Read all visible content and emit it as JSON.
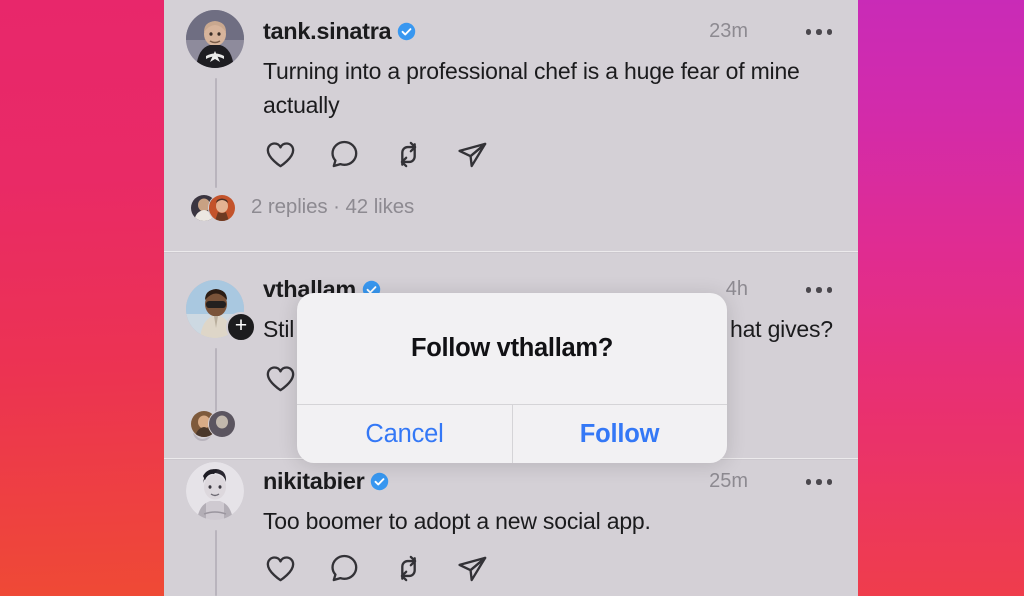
{
  "theme": {
    "background_gradient_left": "#e8276b",
    "background_gradient_right": "#c92bb7",
    "feed_background": "#d4d0d6",
    "verified_badge_color": "#3897f0",
    "alert_tint_color": "#3478f6",
    "text_primary": "#1b1b1d",
    "text_secondary": "#8d8a91"
  },
  "feed": {
    "posts": [
      {
        "id": "post-1",
        "username": "tank.sinatra",
        "verified": true,
        "timestamp": "23m",
        "body": "Turning into a professional chef is a huge fear of mine actually",
        "more_label": "more-options",
        "actions": [
          "like-icon",
          "comment-icon",
          "repost-icon",
          "share-icon"
        ],
        "meta": "2 replies · 42 likes",
        "has_follow_badge": false
      },
      {
        "id": "post-2",
        "username": "vthallam",
        "verified": true,
        "timestamp": "4h",
        "body": "Stil",
        "body_tail": "hat gives?",
        "more_label": "more-options",
        "actions": [
          "like-icon"
        ],
        "meta": "",
        "has_follow_badge": true,
        "follow_badge": "+"
      },
      {
        "id": "post-3",
        "username": "nikitabier",
        "verified": true,
        "timestamp": "25m",
        "body": "Too boomer to adopt a new social app.",
        "more_label": "more-options",
        "actions": [
          "like-icon",
          "comment-icon",
          "repost-icon",
          "share-icon"
        ],
        "meta": "",
        "has_follow_badge": false
      }
    ]
  },
  "alert": {
    "title": "Follow vthallam?",
    "cancel_label": "Cancel",
    "confirm_label": "Follow"
  }
}
